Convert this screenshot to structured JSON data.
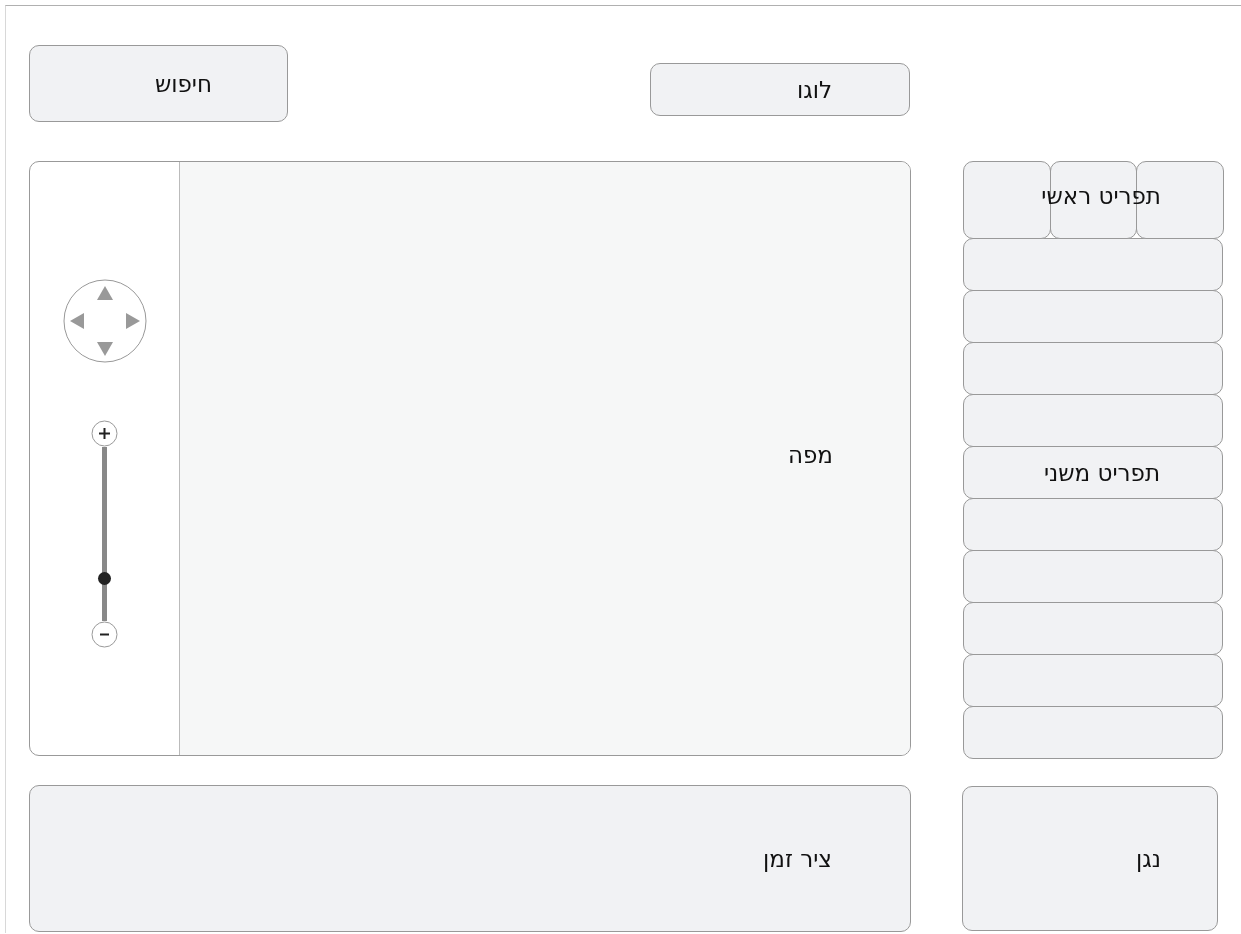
{
  "search": {
    "label": "חיפוש"
  },
  "logo": {
    "label": "לוגו"
  },
  "map": {
    "label": "מפה",
    "zoom": {
      "level": 0.25
    }
  },
  "main_menu": {
    "label": "תפריט ראשי"
  },
  "secondary_menu": {
    "label": "תפריט משני"
  },
  "timeline": {
    "label": "ציר זמן"
  },
  "player": {
    "label": "נגן"
  }
}
